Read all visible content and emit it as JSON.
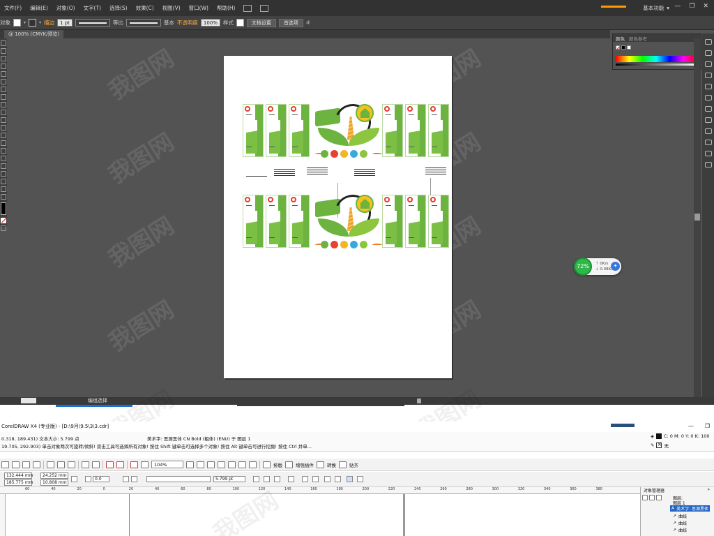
{
  "illustrator": {
    "menu": [
      "文件(F)",
      "编辑(E)",
      "对象(O)",
      "文字(T)",
      "选择(S)",
      "效果(C)",
      "视图(V)",
      "窗口(W)",
      "帮助(H)"
    ],
    "workspace": "基本功能",
    "control": {
      "object_label": "对象",
      "stroke_label": "描边",
      "stroke_weight": "1 pt",
      "stroke_profile": "等比",
      "brush": "基本",
      "opacity_label": "不透明度",
      "opacity_value": "100%",
      "style_label": "样式",
      "doc_setup_button": "文档设置",
      "prefs_button": "首选项"
    },
    "doc_tab": "@ 100% (CMYK/预览)",
    "panel": {
      "tab_color": "颜色",
      "tab_guide": "颜色参考"
    },
    "status": {
      "zoom": "",
      "label": "编组选择"
    },
    "net_monitor": {
      "percent": "72%",
      "upload": "0K/s",
      "download": "0.08K/s"
    }
  },
  "coreldraw": {
    "title": "CorelDRAW X4 (专业版) - [D:\\9月\\9.5\\3\\3.cdr]",
    "info_line1": "0.318, 189.431)  文本大小: 5.799 点",
    "info_line2": "19.705, 292.903)    单击对象两次可旋转/倾斜! 双击工具可选择所有对象! 按住 Shift 键单击可选择多个对象! 按住 Alt 键单击可进行挖掘! 按住 Ctrl 并单...",
    "info_mid": "美术字: 思源黑体 CN Bold (粗体) (ENU) 于 图层 1",
    "fill_info": "C: 0 M: 0 Y: 0 K: 100",
    "outline_info": "无",
    "toolbar": {
      "zoom": "104%",
      "arrange": "排版",
      "plugin": "增强插件",
      "convert": "转换",
      "paste": "贴齐"
    },
    "props": {
      "x": "132.444 mm",
      "y": "185.775 mm",
      "w": "24.252 mm",
      "h": "10.808 mm",
      "angle": "0.0",
      "font_size": "5.799 pt"
    },
    "ruler": [
      "60",
      "40",
      "20",
      "0",
      "20",
      "40",
      "60",
      "80",
      "100",
      "120",
      "140",
      "160",
      "180",
      "200",
      "220",
      "240",
      "260",
      "280",
      "300",
      "320",
      "340",
      "360",
      "380"
    ],
    "object_manager": {
      "title": "对象管理器",
      "layers": [
        "图层:",
        "图层 1"
      ],
      "selected": "美术字: 思源黑体",
      "items": [
        "曲线",
        "曲线",
        "曲线"
      ]
    }
  },
  "colors": {
    "accent_green": "#6cb33f",
    "accent_orange": "#ff9a00",
    "selection_blue": "#1f63c6"
  }
}
